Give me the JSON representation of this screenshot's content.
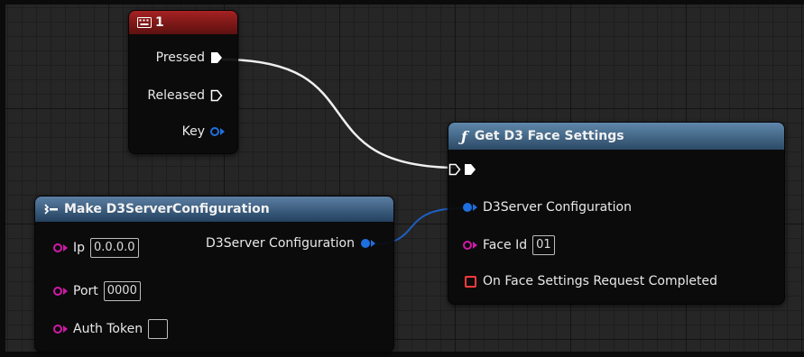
{
  "nodes": {
    "key_event": {
      "title": "1",
      "pins": {
        "pressed": "Pressed",
        "released": "Released",
        "key": "Key"
      }
    },
    "get_face_settings": {
      "title": "Get D3 Face Settings",
      "pins": {
        "config": "D3Server Configuration",
        "face_id_label": "Face Id",
        "face_id_value": "01",
        "completed": "On Face Settings Request Completed"
      }
    },
    "make_config": {
      "title": "Make D3ServerConfiguration",
      "pins": {
        "ip_label": "Ip",
        "ip_value": "0.0.0.0",
        "port_label": "Port",
        "port_value": "0000",
        "auth_label": "Auth Token",
        "auth_value": "",
        "output": "D3Server Configuration"
      }
    }
  },
  "colors": {
    "key_header": "#8a1c1c",
    "function_header": "#3a5f80",
    "make_header": "#2f4f70",
    "exec_pin": "#ffffff",
    "struct_pin": "#1e6fe0",
    "string_pin": "#d01aa8",
    "delegate_pin": "#ff3b3b"
  }
}
